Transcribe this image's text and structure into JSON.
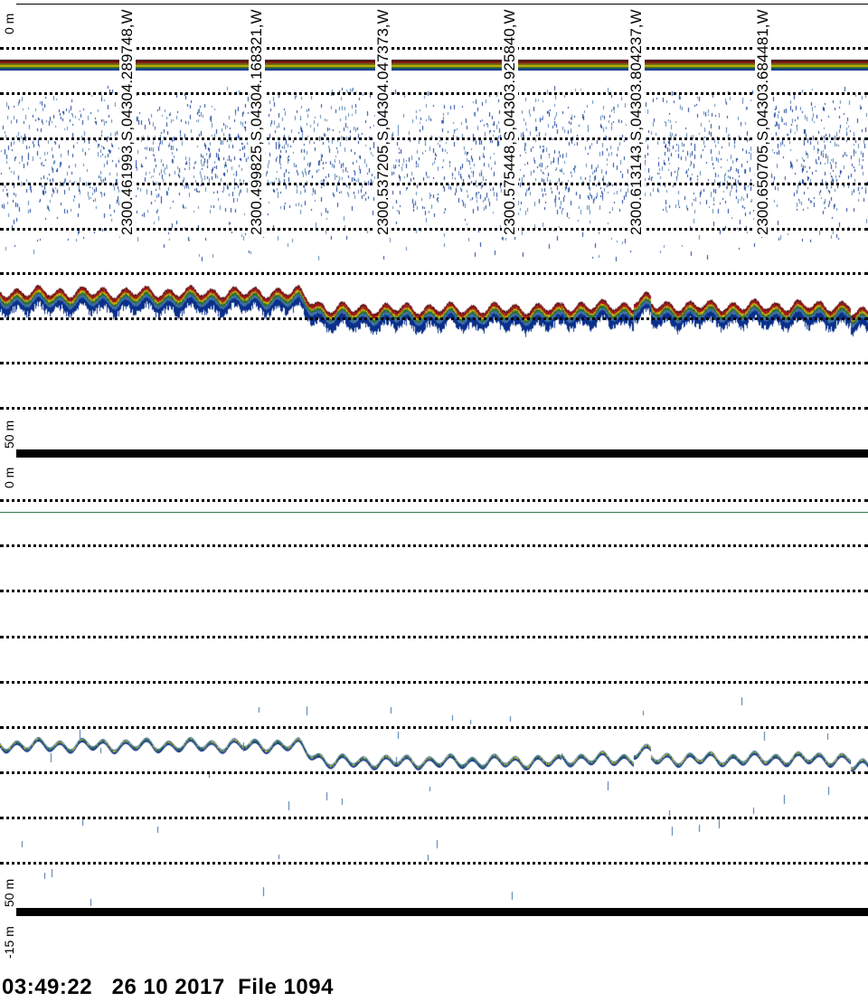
{
  "top_panel": {
    "depth_top": "0 m",
    "depth_bottom": "50 m"
  },
  "bottom_panel": {
    "depth_top": "0 m",
    "depth_bottom": "50 m",
    "depth_offset": "-15 m"
  },
  "position_labels": [
    "2300.461993,S,04304.289748,W",
    "2300.499825,S,04304.168321,W",
    "2300.537205,S,04304.047373,W",
    "2300.575448,S,04303.925840,W",
    "2300.613143,S,04303.804237,W",
    "2300.650705,S,04303.684481,W"
  ],
  "footer": {
    "time": "03:49:22",
    "date": "26 10 2017",
    "file": "File 1094"
  },
  "colors": {
    "echo_palette": [
      "#0a2f8a",
      "#3f6fa8",
      "#2e6b3a",
      "#c9b400",
      "#a01818",
      "#5a1010"
    ],
    "water_line": "#2e7a4a"
  }
}
